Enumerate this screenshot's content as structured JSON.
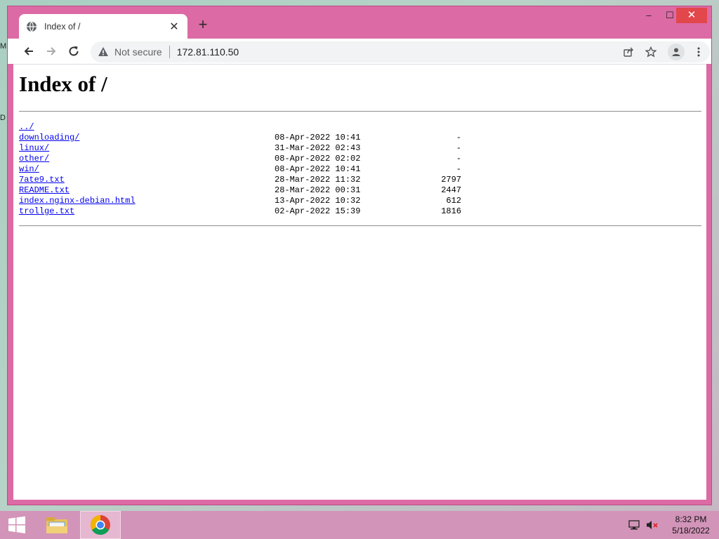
{
  "desktop": {
    "fragments": [
      "M",
      "D"
    ]
  },
  "browser": {
    "tab": {
      "title": "Index of /",
      "close_label": "✕"
    },
    "new_tab_label": "+",
    "window_controls": {
      "minimize": "–",
      "maximize": "☐",
      "close": "✕"
    },
    "omnibox": {
      "security_text": "Not secure",
      "url": "172.81.110.50"
    }
  },
  "page": {
    "heading": "Index of /",
    "entries": [
      {
        "name": "../",
        "date": "",
        "size": ""
      },
      {
        "name": "downloading/",
        "date": "08-Apr-2022 10:41",
        "size": "-"
      },
      {
        "name": "linux/",
        "date": "31-Mar-2022 02:43",
        "size": "-"
      },
      {
        "name": "other/",
        "date": "08-Apr-2022 02:02",
        "size": "-"
      },
      {
        "name": "win/",
        "date": "08-Apr-2022 10:41",
        "size": "-"
      },
      {
        "name": "7ate9.txt",
        "date": "28-Mar-2022 11:32",
        "size": "2797"
      },
      {
        "name": "README.txt",
        "date": "28-Mar-2022 00:31",
        "size": "2447"
      },
      {
        "name": "index.nginx-debian.html",
        "date": "13-Apr-2022 10:32",
        "size": "612"
      },
      {
        "name": "trollge.txt",
        "date": "02-Apr-2022 15:39",
        "size": "1816"
      }
    ]
  },
  "taskbar": {
    "clock": {
      "time": "8:32 PM",
      "date": "5/18/2022"
    },
    "apps": [
      "file-explorer-icon",
      "chrome-icon"
    ]
  },
  "colors": {
    "window_frame": "#dc6aa4",
    "taskbar": "#d394b9",
    "link": "#0000ee",
    "close_button": "#e2474b"
  }
}
